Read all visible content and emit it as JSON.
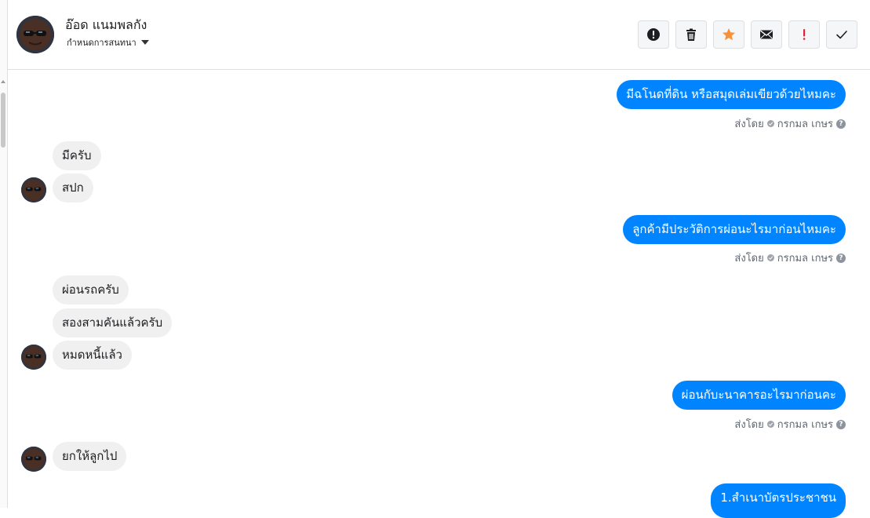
{
  "contact": {
    "name": "อ๊อด แนมพลกัง",
    "setting_label": "กำหนดการสนทนา"
  },
  "toolbar": [
    {
      "name": "mark-spam-button",
      "icon": "alert-circle-icon",
      "color": "#1c1e21"
    },
    {
      "name": "delete-button",
      "icon": "trash-icon",
      "color": "#1c1e21"
    },
    {
      "name": "star-button",
      "icon": "star-icon",
      "color": "#f7923b"
    },
    {
      "name": "mark-unread-button",
      "icon": "envelope-icon",
      "color": "#1c1e21"
    },
    {
      "name": "follow-up-button",
      "icon": "exclamation-icon",
      "color": "#e41e3f"
    },
    {
      "name": "mark-done-button",
      "icon": "checkmark-icon",
      "color": "#1c1e21"
    }
  ],
  "messages": [
    {
      "dir": "out",
      "text": "มีฉโนดที่ดิน หรือสมุดเล่มเขียวด้วยไหมคะ",
      "sent_by_label": "ส่งโดย",
      "sender": "กรกมล เกษร"
    },
    {
      "dir": "in",
      "text": "มีครับ"
    },
    {
      "dir": "in",
      "text": "สปก"
    },
    {
      "dir": "out",
      "text": "ลูกค้ามีประวัติการผ่อนะไรมาก่อนไหมคะ",
      "sent_by_label": "ส่งโดย",
      "sender": "กรกมล เกษร"
    },
    {
      "dir": "in",
      "text": "ผ่อนรถครับ"
    },
    {
      "dir": "in",
      "text": "สองสามคันแล้วครับ"
    },
    {
      "dir": "in",
      "text": "หมดหนี้แล้ว"
    },
    {
      "dir": "out",
      "text": "ผ่อนกับะนาคารอะไรมาก่อนคะ",
      "sent_by_label": "ส่งโดย",
      "sender": "กรกมล เกษร"
    },
    {
      "dir": "in",
      "text": "ยกให้ลูกไป"
    },
    {
      "dir": "out",
      "text": "1.สำเนาบัตรประชาชน"
    }
  ],
  "colors": {
    "outgoing_bubble": "#0084ff",
    "incoming_bubble": "#f1f0f0",
    "divider": "#dddfe2"
  }
}
